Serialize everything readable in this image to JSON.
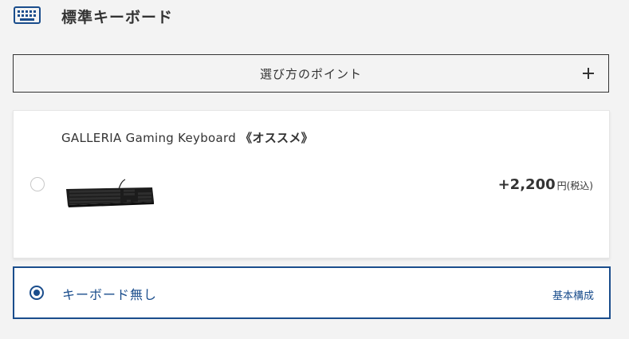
{
  "section": {
    "title": "標準キーボード",
    "icon": "keyboard-icon"
  },
  "points": {
    "label": "選び方のポイント",
    "icon": "plus-icon"
  },
  "options": [
    {
      "name": "GALLERIA Gaming Keyboard",
      "tag": "《オススメ》",
      "price": "+2,200",
      "price_unit": "円(税込)",
      "selected": false
    },
    {
      "name": "キーボード無し",
      "note": "基本構成",
      "selected": true
    }
  ],
  "colors": {
    "accent": "#1a4d8c",
    "text": "#333333",
    "background": "#f3f3f3",
    "card": "#ffffff"
  }
}
